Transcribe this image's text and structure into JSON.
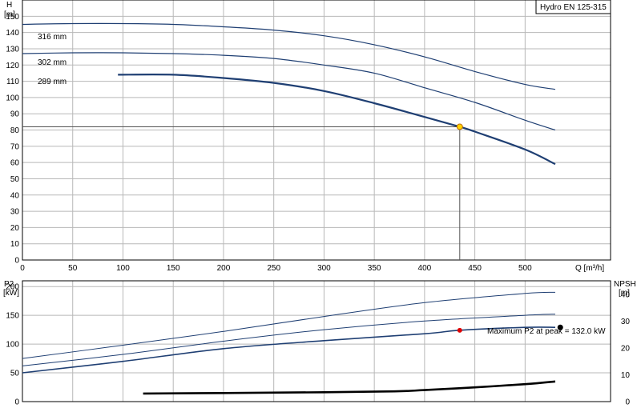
{
  "chart_data": [
    {
      "type": "line",
      "title": "Hydro EN 125-315",
      "xlabel": "Q [m³/h]",
      "ylabel": [
        "H",
        "[m]"
      ],
      "xlim": [
        0,
        585
      ],
      "ylim": [
        0,
        160
      ],
      "grid": true,
      "x_ticks": [
        0,
        50,
        100,
        150,
        200,
        250,
        300,
        350,
        400,
        450,
        500
      ],
      "y_ticks": [
        0,
        10,
        20,
        30,
        40,
        50,
        60,
        70,
        80,
        90,
        100,
        110,
        120,
        130,
        140,
        150
      ],
      "series": [
        {
          "name": "316 mm",
          "x": [
            0,
            50,
            100,
            150,
            200,
            250,
            300,
            350,
            400,
            450,
            500,
            530
          ],
          "y": [
            145,
            145.5,
            145.5,
            145,
            143.5,
            141.5,
            138,
            132.5,
            125,
            116,
            108,
            105
          ]
        },
        {
          "name": "302 mm",
          "x": [
            0,
            50,
            100,
            150,
            200,
            250,
            300,
            350,
            400,
            450,
            500,
            530
          ],
          "y": [
            127,
            127.5,
            127.5,
            127,
            126,
            124,
            120,
            115,
            106,
            97,
            86,
            80
          ]
        },
        {
          "name": "289 mm",
          "x": [
            95,
            150,
            200,
            250,
            300,
            350,
            400,
            435,
            450,
            500,
            530
          ],
          "y": [
            114,
            114,
            112,
            109,
            104,
            96.5,
            88,
            82,
            79,
            68,
            59
          ]
        }
      ],
      "operating_point": {
        "x": 435,
        "y": 82
      }
    },
    {
      "type": "line",
      "ylabel": [
        "P2",
        "[kW]"
      ],
      "ylabel_right": [
        "NPSH",
        "[m]"
      ],
      "xlim": [
        0,
        585
      ],
      "ylim": [
        0,
        210
      ],
      "y_ticks": [
        0,
        50,
        100,
        150,
        200
      ],
      "ylim_right": [
        0,
        45
      ],
      "y_ticks_right": [
        0,
        10,
        20,
        30,
        40
      ],
      "grid": true,
      "power_series": [
        {
          "x": [
            0,
            100,
            200,
            300,
            400,
            500,
            530
          ],
          "y": [
            75,
            98,
            122,
            148,
            172,
            188,
            190
          ]
        },
        {
          "x": [
            0,
            100,
            200,
            300,
            400,
            500,
            530
          ],
          "y": [
            62,
            82,
            105,
            125,
            140,
            150,
            152
          ]
        },
        {
          "x": [
            0,
            100,
            200,
            300,
            400,
            435,
            500,
            530
          ],
          "y": [
            50,
            70,
            92,
            106,
            118,
            124,
            129,
            129
          ]
        }
      ],
      "npsh_series": {
        "x": [
          120,
          200,
          300,
          370,
          400,
          450,
          500,
          530
        ],
        "y": [
          3,
          3.2,
          3.5,
          3.8,
          4.3,
          5.3,
          6.5,
          7.5
        ]
      },
      "power_point": {
        "x": 435,
        "y": 124
      },
      "peak_point": {
        "x": 535,
        "y": 129
      },
      "annotation": "Maximum P2 at peak = 132.0 kW"
    }
  ],
  "colors": {
    "curve": "#1f3f73",
    "grid": "#b8b8b8",
    "point_fill": "#ffd400",
    "point_stroke": "#c07000",
    "power_point": "#e00000"
  }
}
